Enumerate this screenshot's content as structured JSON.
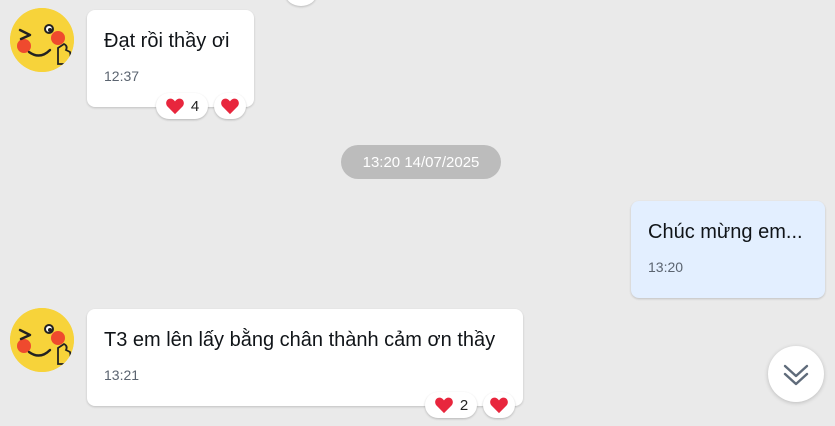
{
  "messages": [
    {
      "text": "Đạt rồi thầy ơi",
      "time": "12:37",
      "reaction_count": "4"
    },
    {
      "text": "Chúc mừng em...",
      "time": "13:20"
    },
    {
      "text": "T3 em lên lấy bằng chân thành cảm ơn thầy",
      "time": "13:21",
      "reaction_count": "2"
    }
  ],
  "date_separator": "13:20 14/07/2025",
  "icons": {
    "avatar": "wink-thumbs-up-emoji-avatar",
    "reaction": "heart-icon",
    "scroll": "double-chevron-down-icon"
  },
  "colors": {
    "background": "#eaeaea",
    "incoming_bubble": "#ffffff",
    "outgoing_bubble": "#e3efff",
    "heart": "#e8263d",
    "date_pill": "#bcbcbc"
  }
}
